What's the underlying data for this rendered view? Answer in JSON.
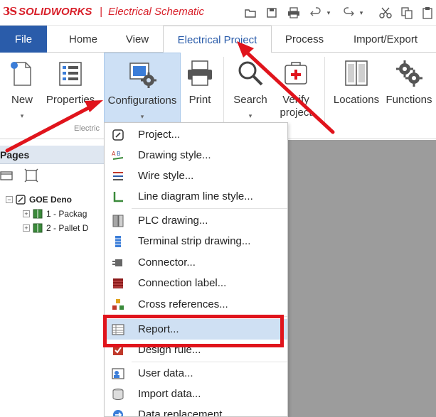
{
  "titlebar": {
    "logo": "3S",
    "brand": "SOLIDWORKS",
    "separator": "|",
    "product": "Electrical Schematic"
  },
  "quick_access": [
    {
      "icon": "open-folder-icon"
    },
    {
      "icon": "save-icon"
    },
    {
      "icon": "print-icon"
    },
    {
      "icon": "undo-icon"
    },
    {
      "icon": "redo-icon"
    },
    {
      "icon": "cut-icon"
    },
    {
      "icon": "copy-icon"
    }
  ],
  "tabs": [
    {
      "label": "File"
    },
    {
      "label": "Home"
    },
    {
      "label": "View"
    },
    {
      "label": "Electrical Project"
    },
    {
      "label": "Process"
    },
    {
      "label": "Import/Export"
    }
  ],
  "ribbon": {
    "buttons": [
      {
        "label": "New",
        "icon": "new-document-icon"
      },
      {
        "label": "Properties",
        "icon": "properties-icon"
      },
      {
        "label": "Configurations",
        "icon": "configurations-icon"
      },
      {
        "label": "Print",
        "icon": "print-icon"
      },
      {
        "label": "Search",
        "icon": "search-icon"
      },
      {
        "label": "Verify",
        "label2": "project",
        "icon": "verify-project-icon"
      },
      {
        "label": "Locations",
        "icon": "locations-icon"
      },
      {
        "label": "Functions",
        "icon": "functions-icon"
      }
    ],
    "group_label": "Electric"
  },
  "pages_panel": {
    "title": "Pages",
    "tree": {
      "root": "GOE Deno",
      "children": [
        {
          "label": "1 - Packag"
        },
        {
          "label": "2 - Pallet D"
        }
      ]
    }
  },
  "configurations_menu": {
    "items": [
      {
        "label": "Project...",
        "icon": "project-icon"
      },
      {
        "label": "Drawing style...",
        "icon": "drawing-style-icon"
      },
      {
        "label": "Wire style...",
        "icon": "wire-style-icon"
      },
      {
        "label": "Line diagram line style...",
        "icon": "line-diagram-icon"
      },
      {
        "label": "PLC drawing...",
        "icon": "plc-drawing-icon"
      },
      {
        "label": "Terminal strip drawing...",
        "icon": "terminal-strip-icon"
      },
      {
        "label": "Connector...",
        "icon": "connector-icon"
      },
      {
        "label": "Connection label...",
        "icon": "connection-label-icon"
      },
      {
        "label": "Cross references...",
        "icon": "cross-references-icon"
      },
      {
        "label": "Report...",
        "icon": "report-icon"
      },
      {
        "label": "Design rule...",
        "icon": "design-rule-icon"
      },
      {
        "label": "User data...",
        "icon": "user-data-icon"
      },
      {
        "label": "Import data...",
        "icon": "import-data-icon"
      },
      {
        "label": "Data replacement",
        "icon": "data-replacement-icon"
      }
    ],
    "highlighted": "Report..."
  },
  "colors": {
    "brand_red": "#d8202a",
    "file_tab": "#2a5caa",
    "active_tab_text": "#2a5caa",
    "highlight": "#cfe0f3",
    "annotation_red": "#e0141c",
    "workspace": "#9c9c9c"
  }
}
